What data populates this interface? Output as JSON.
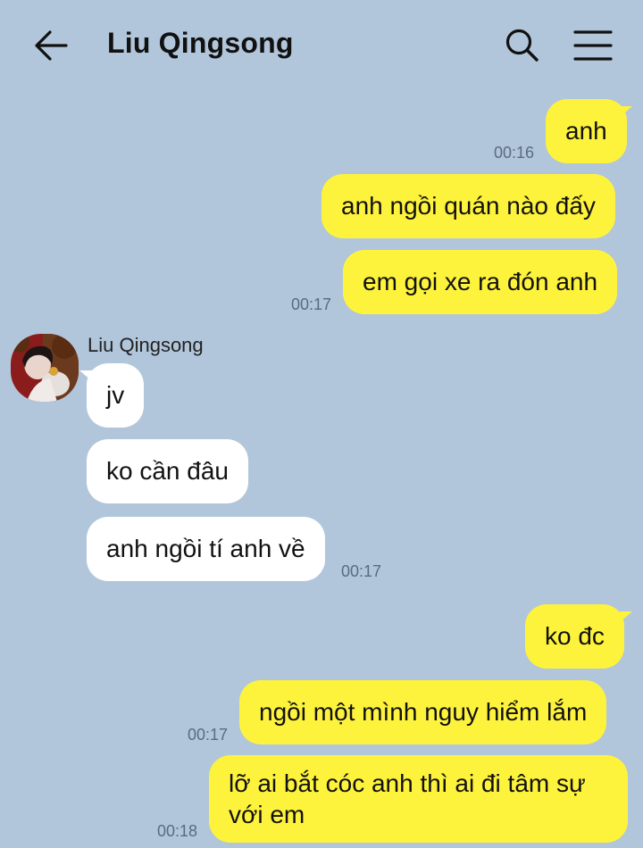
{
  "header": {
    "title": "Liu Qingsong",
    "back_icon": "arrow-left-icon",
    "search_icon": "search-icon",
    "menu_icon": "hamburger-menu-icon"
  },
  "contact": {
    "name": "Liu Qingsong"
  },
  "messages": [
    {
      "direction": "out",
      "text": "anh"
    },
    {
      "direction": "out",
      "text": "anh ngồi quán nào đấy"
    },
    {
      "direction": "out",
      "text": "em gọi xe ra đón anh"
    },
    {
      "direction": "in",
      "text": "jv"
    },
    {
      "direction": "in",
      "text": "ko cần đâu"
    },
    {
      "direction": "in",
      "text": "anh ngồi tí anh về"
    },
    {
      "direction": "out",
      "text": "ko đc"
    },
    {
      "direction": "out",
      "text": "ngồi một mình nguy hiểm lắm"
    },
    {
      "direction": "out",
      "text": "lỡ ai bắt cóc anh thì ai đi tâm sự với em"
    }
  ],
  "timestamps": [
    "00:16",
    "00:17",
    "00:17",
    "00:17",
    "00:18"
  ],
  "colors": {
    "background": "#b1c6db",
    "outgoing_bubble": "#fef33c",
    "incoming_bubble": "#ffffff",
    "timestamp": "#5b6b7b"
  }
}
